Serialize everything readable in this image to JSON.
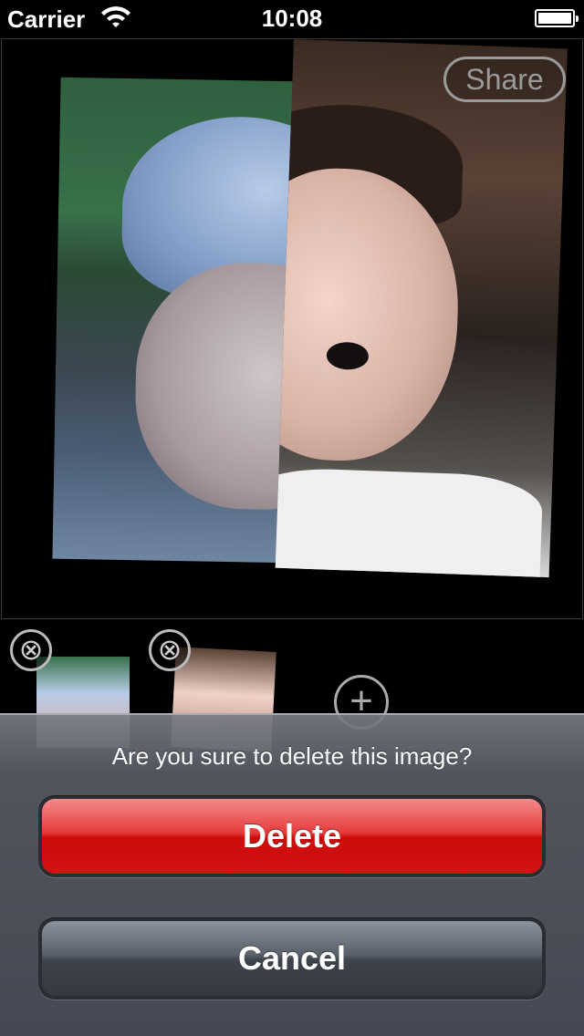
{
  "status_bar": {
    "carrier": "Carrier",
    "time": "10:08",
    "battery_level": 0.9
  },
  "canvas": {
    "share_label": "Share"
  },
  "thumbnails": {
    "remove_symbol": "⊗",
    "remove_icon": "close-circle-icon",
    "add_symbol": "+",
    "add_icon": "plus-circle-icon"
  },
  "action_sheet": {
    "message": "Are you sure to delete this image?",
    "delete_label": "Delete",
    "cancel_label": "Cancel",
    "delete_color": "#d11414",
    "cancel_color": "#3e434c"
  }
}
